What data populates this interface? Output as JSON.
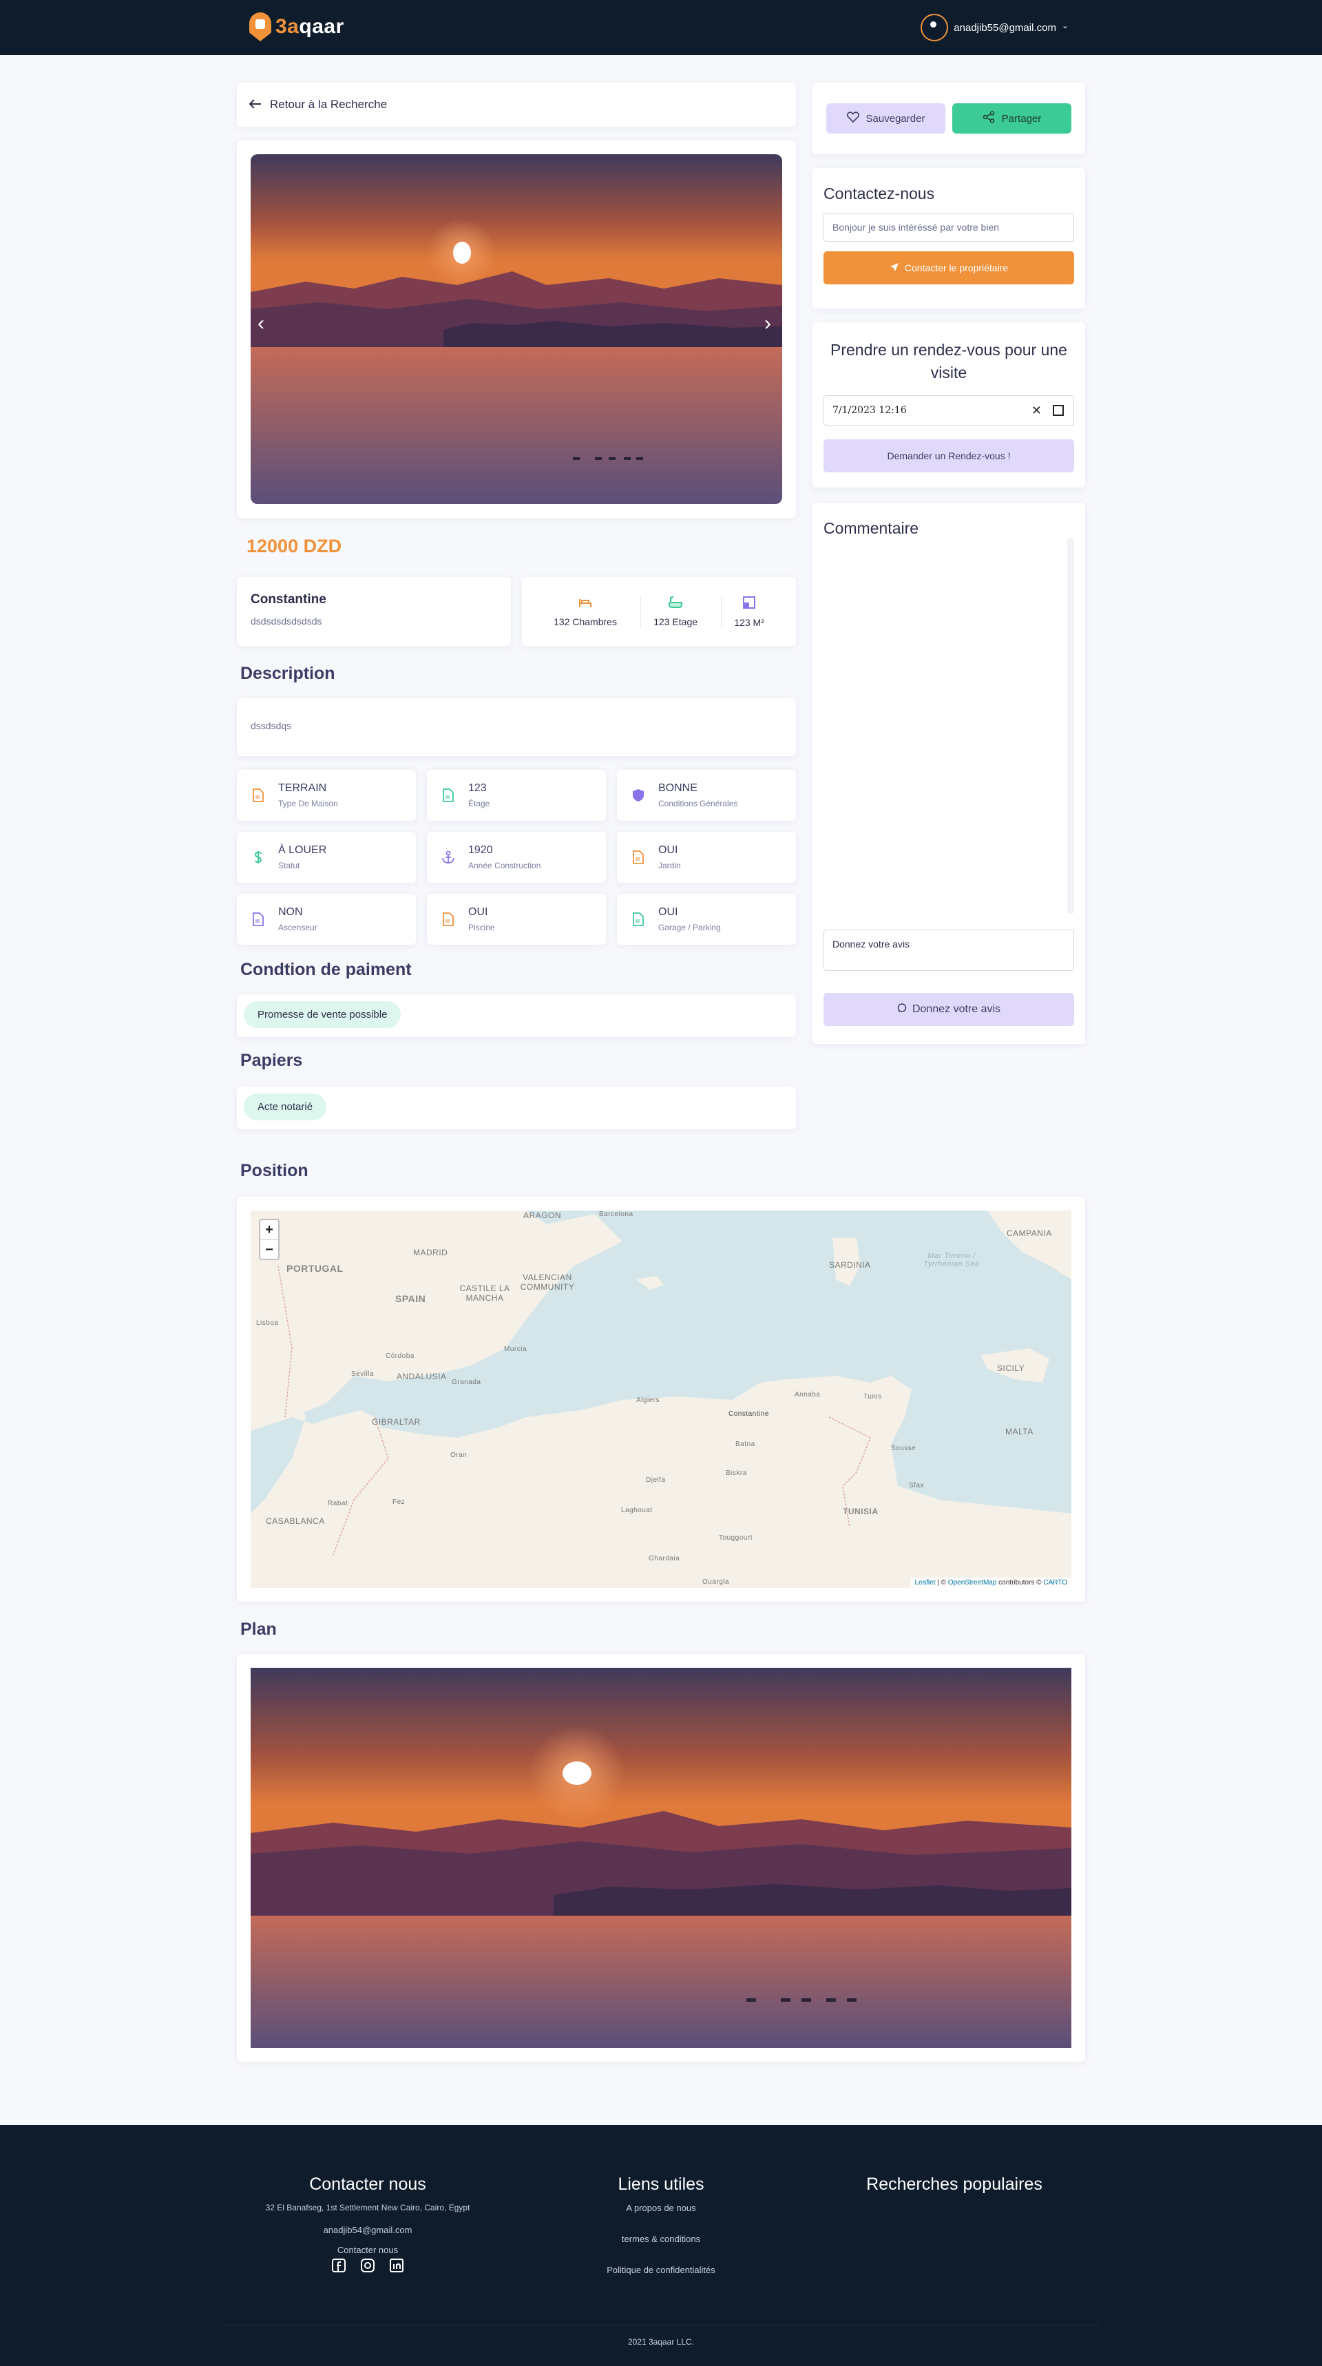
{
  "header": {
    "logo_text_accent": "3a",
    "logo_text_rest": "qaar",
    "user_email": "anadjib55@gmail.com",
    "chevron": "⌄"
  },
  "back_link": {
    "label": "Retour à la Recherche",
    "icon": "arrow-left-icon"
  },
  "gallery": {
    "prev": "‹",
    "next": "›"
  },
  "listing": {
    "price": "12000 DZD",
    "city": "Constantine",
    "address": "dsdsdsdsdsdsds",
    "stats": [
      {
        "label": "132 Chambres",
        "icon": "bed-icon",
        "color": "#f0923a"
      },
      {
        "label": "123 Etage",
        "icon": "bath-icon",
        "color": "#3ccb96"
      },
      {
        "label": "123 M²",
        "icon": "area-icon",
        "color": "#8a72e8"
      }
    ]
  },
  "description": {
    "title": "Description",
    "text": "dssdsdqs"
  },
  "features": [
    {
      "value": "TERRAIN",
      "label": "Type De Maison",
      "icon": "document-icon",
      "color": "#f0923a"
    },
    {
      "value": "123",
      "label": "Étage",
      "icon": "document-icon",
      "color": "#3ccb96"
    },
    {
      "value": "BONNE",
      "label": "Conditions Générales",
      "icon": "shield-icon",
      "color": "#8a72e8"
    },
    {
      "value": "À LOUER",
      "label": "Statut",
      "icon": "dollar-icon",
      "color": "#3ccb96"
    },
    {
      "value": "1920",
      "label": "Année Construction",
      "icon": "anchor-icon",
      "color": "#8a72e8"
    },
    {
      "value": "OUI",
      "label": "Jardin",
      "icon": "document-icon",
      "color": "#f0923a"
    },
    {
      "value": "NON",
      "label": "Ascenseur",
      "icon": "document-icon",
      "color": "#8a72e8"
    },
    {
      "value": "OUI",
      "label": "Piscine",
      "icon": "document-icon",
      "color": "#f0923a"
    },
    {
      "value": "OUI",
      "label": "Garage / Parking",
      "icon": "document-icon",
      "color": "#3ccb96"
    }
  ],
  "payment": {
    "title": "Condtion de paiment",
    "chip": "Promesse de vente possible"
  },
  "papers": {
    "title": "Papiers",
    "chip": "Acte notarié"
  },
  "actions": {
    "save": "Sauvegarder",
    "share": "Partager"
  },
  "contact": {
    "title": "Contactez-nous",
    "message": "Bonjour je suis intéréssé par votre bien",
    "button": "Contacter le propriétaire"
  },
  "appointment": {
    "title": "Prendre un rendez-vous pour une visite",
    "datetime": "7/1/2023 12:16",
    "clear": "✕",
    "button": "Demander un Rendez-vous !"
  },
  "comments": {
    "title": "Commentaire",
    "placeholder": "Donnez votre avis",
    "button": "Donnez votre avis"
  },
  "map": {
    "title": "Position",
    "zoom_in": "+",
    "zoom_out": "−",
    "attribution": {
      "leaflet": "Leaflet",
      "sep": " | © ",
      "osm": "OpenStreetMap",
      "mid": " contributors © ",
      "carto": "CARTO"
    },
    "labels": {
      "portugal": "PORTUGAL",
      "spain": "SPAIN",
      "madrid": "MADRID",
      "aragon": "ARAGON",
      "barcelona": "Barcelona",
      "castilla": "CASTILE LA MANCHA",
      "valencian": "VALENCIAN COMMUNITY",
      "andalusia": "ANDALUSIA",
      "gibraltar": "GIBRALTAR",
      "casablanca": "CASABLANCA",
      "sardinia": "SARDINIA",
      "campania": "CAMPANIA",
      "sicily": "SICILY",
      "malta": "MALTA",
      "tunisia": "TUNISIA",
      "constantine": "Constantine",
      "algiers": "Algiers",
      "tunis": "Tunis",
      "annaba": "Annaba",
      "oran": "Oran",
      "batna": "Batna",
      "biskra": "Biskra",
      "djelfa": "Djelfa",
      "laghouat": "Laghouat",
      "ghardaia": "Ghardaia",
      "ouargla": "Ouargla",
      "touggourt": "Touggourt",
      "sousse": "Sousse",
      "sfax": "Sfax",
      "murcia": "Murcia",
      "cordoba": "Córdoba",
      "granada": "Granada",
      "sevilla": "Sevilla",
      "fez": "Fez",
      "rabat": "Rabat",
      "lisbon": "Lisboa",
      "tyrrhenian": "Mar Tirreno / Tyrrhenian Sea"
    }
  },
  "plan": {
    "title": "Plan"
  },
  "footer": {
    "contact_title": "Contacter nous",
    "address": "32 El Banafseg, 1st Settlement New Cairo, Cairo, Egypt",
    "email": "anadjib54@gmail.com",
    "contact_link": "Contacter nous",
    "links_title": "Liens utiles",
    "links": [
      "A propos de nous",
      "termes & conditions",
      "Politique de confidentialités"
    ],
    "popular_title": "Recherches populaires",
    "copyright": "2021 3aqaar LLC."
  },
  "colors": {
    "navy": "#0e1c2c",
    "orange": "#f0923a",
    "green": "#3ccb96",
    "lavender": "#e1d9fb",
    "purple": "#8a72e8"
  }
}
